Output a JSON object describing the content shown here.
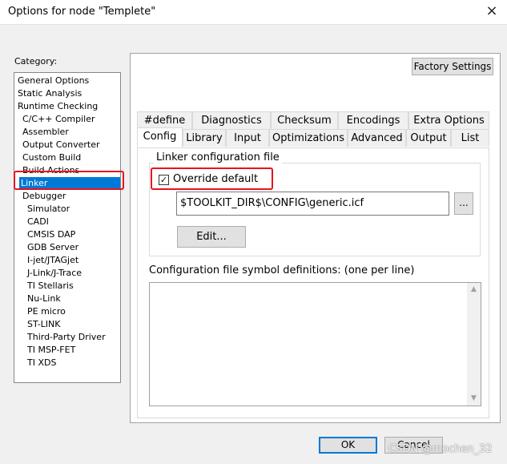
{
  "window": {
    "title": "Options for node \"Templete\"",
    "close_icon": "×"
  },
  "category": {
    "label": "Category:",
    "items": [
      "General Options",
      "Static Analysis",
      "Runtime Checking",
      "C/C++ Compiler",
      "Assembler",
      "Output Converter",
      "Custom Build",
      "Build Actions",
      "Linker",
      "Debugger",
      "Simulator",
      "CADI",
      "CMSIS DAP",
      "GDB Server",
      "I-jet/JTAGjet",
      "J-Link/J-Trace",
      "TI Stellaris",
      "Nu-Link",
      "PE micro",
      "ST-LINK",
      "Third-Party Driver",
      "TI MSP-FET",
      "TI XDS"
    ],
    "selected": "Linker"
  },
  "factory_settings_label": "Factory Settings",
  "tabs": {
    "back_row": [
      "#define",
      "Diagnostics",
      "Checksum",
      "Encodings",
      "Extra Options"
    ],
    "front_row": [
      "Config",
      "Library",
      "Input",
      "Optimizations",
      "Advanced",
      "Output",
      "List"
    ],
    "active": "Config"
  },
  "config": {
    "group_title": "Linker configuration file",
    "override_label": "Override default",
    "override_checked": true,
    "checkbox_mark": "✓",
    "config_file_value": "$TOOLKIT_DIR$\\CONFIG\\generic.icf",
    "browse_label": "...",
    "edit_label": "Edit...",
    "defs_label": "Configuration file symbol definitions: (one per line)",
    "defs_value": "",
    "scroll_up": "▲",
    "scroll_down": "▼"
  },
  "buttons": {
    "ok": "OK",
    "cancel": "Cancel"
  },
  "watermark": "CSDN @mochen_32",
  "colors": {
    "selection": "#0078d7",
    "highlight": "#e8141c",
    "panel": "#f0f0f0"
  }
}
